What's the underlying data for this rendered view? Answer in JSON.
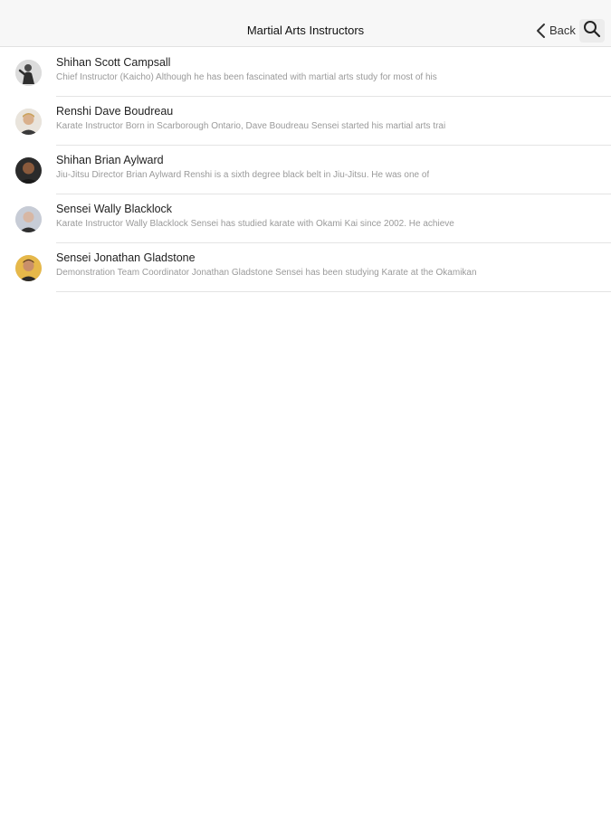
{
  "navbar": {
    "title": "Martial Arts Instructors",
    "back_label": "Back",
    "back_icon": "chevron-left-icon",
    "search_icon": "search-icon"
  },
  "instructors": [
    {
      "name": "Shihan Scott Campsall",
      "summary": "Chief Instructor (Kaicho) Although he has been fascinated with martial arts study for most of his"
    },
    {
      "name": "Renshi Dave Boudreau",
      "summary": "Karate Instructor Born in Scarborough Ontario, Dave Boudreau Sensei started his martial arts trai"
    },
    {
      "name": "Shihan Brian Aylward",
      "summary": "Jiu-Jitsu Director Brian Aylward Renshi is a sixth degree black belt in Jiu-Jitsu. He was one of"
    },
    {
      "name": "Sensei Wally Blacklock",
      "summary": "Karate Instructor Wally Blacklock Sensei has studied karate with Okami Kai since 2002. He achieve"
    },
    {
      "name": "Sensei Jonathan Gladstone",
      "summary": "Demonstration Team Coordinator Jonathan Gladstone Sensei has been studying Karate at the Okamikan"
    }
  ]
}
